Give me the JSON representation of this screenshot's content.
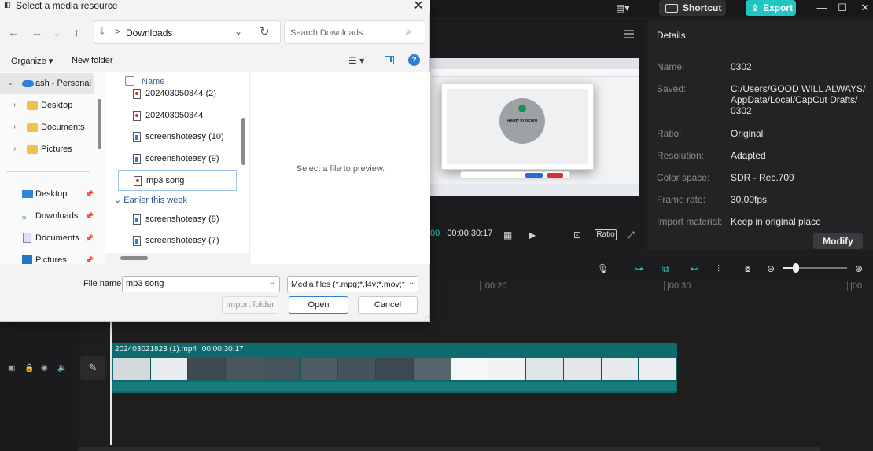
{
  "capcut": {
    "toolbar": {
      "shortcut_label": "Shortcut",
      "export_label": "Export"
    },
    "player": {
      "current_time": "00",
      "total_time": "00:00:30:17",
      "ratio_label": "Ratio"
    },
    "details": {
      "title": "Details",
      "rows": [
        {
          "label": "Name:",
          "value": "0302"
        },
        {
          "label": "Saved:",
          "value": "C:/Users/GOOD WILL ALWAYS/ AppData/Local/CapCut Drafts/ 0302"
        },
        {
          "label": "Ratio:",
          "value": "Original"
        },
        {
          "label": "Resolution:",
          "value": "Adapted"
        },
        {
          "label": "Color space:",
          "value": "SDR - Rec.709"
        },
        {
          "label": "Frame rate:",
          "value": "30.00fps"
        },
        {
          "label": "Import material:",
          "value": "Keep in original place"
        }
      ],
      "modify_label": "Modify"
    },
    "timeline": {
      "ticks": [
        "|00:20",
        "|00:30",
        "|00:"
      ],
      "zoom_level": 0.2,
      "clip": {
        "name": "202403021823 (1).mp4",
        "duration": "00:00:30:17"
      }
    },
    "preview_video": {
      "ready_text": "Ready to record"
    }
  },
  "dialog": {
    "title": "Select a media resource",
    "close_glyph": "✕",
    "address": {
      "location": "Downloads",
      "separator": ">"
    },
    "search": {
      "placeholder": "Search Downloads"
    },
    "commands": {
      "organize": "Organize",
      "new_folder": "New folder"
    },
    "nav": {
      "root": "ash - Personal",
      "folders": [
        "Desktop",
        "Documents",
        "Pictures"
      ],
      "quick_access": [
        "Desktop",
        "Downloads",
        "Documents",
        "Pictures"
      ]
    },
    "files": {
      "column_header": "Name",
      "items_top": [
        {
          "name": "202403050844 (2)",
          "type": "media"
        },
        {
          "name": "202403050844",
          "type": "media"
        },
        {
          "name": "screenshoteasy (10)",
          "type": "doc"
        },
        {
          "name": "screenshoteasy (9)",
          "type": "doc"
        },
        {
          "name": "mp3 song",
          "type": "media",
          "selected": true
        }
      ],
      "group_label": "Earlier this week",
      "items_group": [
        {
          "name": "screenshoteasy (8)",
          "type": "doc"
        },
        {
          "name": "screenshoteasy (7)",
          "type": "doc"
        }
      ]
    },
    "preview_message": "Select a file to preview.",
    "footer": {
      "file_name_label": "File name:",
      "file_name_value": "mp3 song",
      "filter_value": "Media files (*.mpg;*.f4v;*.mov;*",
      "import_folder_label": "Import folder",
      "open_label": "Open",
      "cancel_label": "Cancel"
    }
  }
}
